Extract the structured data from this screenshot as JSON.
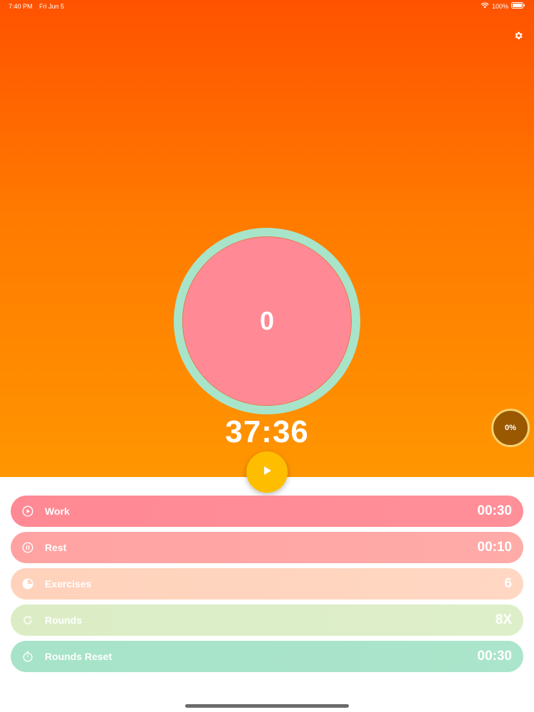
{
  "status_bar": {
    "time": "7:40 PM",
    "date": "Fri Jun 5",
    "battery": "100%",
    "icons": [
      "wifi-icon",
      "battery-icon"
    ]
  },
  "header": {
    "settings_icon": "gear-icon"
  },
  "timer": {
    "count": "0",
    "total_time": "37:36",
    "progress_label": "0%",
    "progress": 0,
    "play_icon": "play-icon"
  },
  "settings_rows": [
    {
      "label": "Work",
      "value": "00:30",
      "icon": "play-circle-icon",
      "color": "#ff8a96"
    },
    {
      "label": "Rest",
      "value": "00:10",
      "icon": "pause-circle-icon",
      "color": "#ffa7a6"
    },
    {
      "label": "Exercises",
      "value": "6",
      "icon": "pie-icon",
      "color": "#ffd4bc"
    },
    {
      "label": "Rounds",
      "value": "8X",
      "icon": "refresh-icon",
      "color": "#ddeec7"
    },
    {
      "label": "Rounds Reset",
      "value": "00:30",
      "icon": "stopwatch-icon",
      "color": "#a8e4c9"
    }
  ],
  "colors": {
    "gradient_top": "#ff5200",
    "gradient_bottom": "#ff9600",
    "ring": "#a8e4c9",
    "inner_circle": "#ff8a96",
    "play_button": "#ffbd00",
    "badge": "#9a5800"
  }
}
